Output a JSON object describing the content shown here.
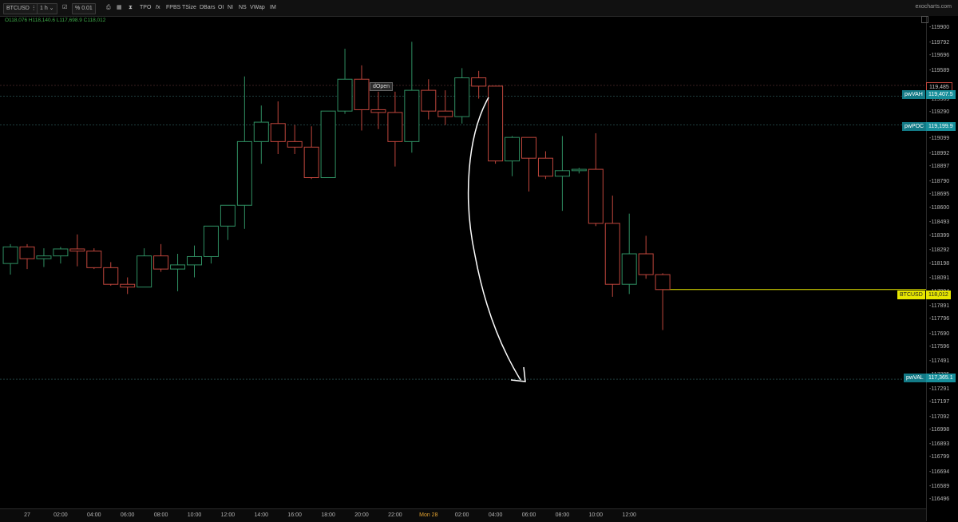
{
  "toolbar": {
    "symbol": "BTCUSD",
    "timeframe": "1 h",
    "percent_label": "%",
    "percent_value": "0.01",
    "items": [
      "TPO",
      "FPBS",
      "TSize",
      "DBars",
      "OI",
      "NI",
      "NS",
      "VWap",
      "IM"
    ]
  },
  "ohlc_line": "O118,076 H118,140.6 L117,698.9 C118,012",
  "brand": "exocharts.com",
  "annotation": "dOpen",
  "levels": [
    {
      "name": "pwVAH",
      "price": "119,407.5"
    },
    {
      "name": "pwPOC",
      "price": "119,199.9"
    },
    {
      "name": "pwVAL",
      "price": "117,365.1"
    }
  ],
  "current": {
    "symbol": "BTCUSD",
    "price": "118,012"
  },
  "top_price_label": "119,485",
  "colors": {
    "up": "#2f8f62",
    "down": "#c0463c",
    "background": "#000000",
    "level": "#178f9b",
    "current": "#e6e600"
  },
  "chart_data": {
    "type": "candlestick",
    "price_ticks": [
      119900,
      119792,
      119696,
      119589,
      119485,
      119383,
      119290,
      119190,
      119099,
      118992,
      118897,
      118790,
      118695,
      118600,
      118493,
      118399,
      118292,
      118198,
      118091,
      117994,
      117891,
      117796,
      117690,
      117596,
      117491,
      117395,
      117291,
      117197,
      117092,
      116998,
      116893,
      116799,
      116694,
      116589,
      116496
    ],
    "time_labels": [
      {
        "label": "27",
        "hour": 0
      },
      {
        "label": "02:00",
        "hour": 2
      },
      {
        "label": "04:00",
        "hour": 4
      },
      {
        "label": "06:00",
        "hour": 6
      },
      {
        "label": "08:00",
        "hour": 8
      },
      {
        "label": "10:00",
        "hour": 10
      },
      {
        "label": "12:00",
        "hour": 12
      },
      {
        "label": "14:00",
        "hour": 14
      },
      {
        "label": "16:00",
        "hour": 16
      },
      {
        "label": "18:00",
        "hour": 18
      },
      {
        "label": "20:00",
        "hour": 20
      },
      {
        "label": "22:00",
        "hour": 22
      },
      {
        "label": "Mon 28",
        "hour": 24
      },
      {
        "label": "02:00",
        "hour": 26
      },
      {
        "label": "04:00",
        "hour": 28
      },
      {
        "label": "06:00",
        "hour": 30
      },
      {
        "label": "08:00",
        "hour": 32
      },
      {
        "label": "10:00",
        "hour": 34
      },
      {
        "label": "12:00",
        "hour": 36
      }
    ],
    "candles": [
      {
        "h": -1,
        "o": 118200,
        "hi": 118340,
        "l": 118120,
        "c": 118320
      },
      {
        "h": 0,
        "o": 118320,
        "hi": 118340,
        "l": 118160,
        "c": 118235
      },
      {
        "h": 1,
        "o": 118235,
        "hi": 118310,
        "l": 118175,
        "c": 118255
      },
      {
        "h": 2,
        "o": 118255,
        "hi": 118320,
        "l": 118200,
        "c": 118305
      },
      {
        "h": 3,
        "o": 118305,
        "hi": 118410,
        "l": 118180,
        "c": 118290
      },
      {
        "h": 4,
        "o": 118290,
        "hi": 118310,
        "l": 118160,
        "c": 118170
      },
      {
        "h": 5,
        "o": 118170,
        "hi": 118210,
        "l": 118040,
        "c": 118050
      },
      {
        "h": 6,
        "o": 118050,
        "hi": 118100,
        "l": 117980,
        "c": 118030
      },
      {
        "h": 7,
        "o": 118030,
        "hi": 118310,
        "l": 118030,
        "c": 118255
      },
      {
        "h": 8,
        "o": 118255,
        "hi": 118340,
        "l": 118140,
        "c": 118160
      },
      {
        "h": 9,
        "o": 118160,
        "hi": 118270,
        "l": 118000,
        "c": 118190
      },
      {
        "h": 10,
        "o": 118190,
        "hi": 118330,
        "l": 118100,
        "c": 118250
      },
      {
        "h": 11,
        "o": 118250,
        "hi": 118460,
        "l": 118200,
        "c": 118470
      },
      {
        "h": 12,
        "o": 118470,
        "hi": 118600,
        "l": 118370,
        "c": 118620
      },
      {
        "h": 13,
        "o": 118620,
        "hi": 119550,
        "l": 118450,
        "c": 119080
      },
      {
        "h": 14,
        "o": 119080,
        "hi": 119340,
        "l": 118920,
        "c": 119220
      },
      {
        "h": 15,
        "o": 119210,
        "hi": 119370,
        "l": 118990,
        "c": 119080
      },
      {
        "h": 16,
        "o": 119080,
        "hi": 119200,
        "l": 118990,
        "c": 119040
      },
      {
        "h": 17,
        "o": 119040,
        "hi": 119190,
        "l": 118810,
        "c": 118820
      },
      {
        "h": 18,
        "o": 118820,
        "hi": 119250,
        "l": 118820,
        "c": 119300
      },
      {
        "h": 19,
        "o": 119300,
        "hi": 119750,
        "l": 119280,
        "c": 119530
      },
      {
        "h": 20,
        "o": 119530,
        "hi": 119630,
        "l": 119160,
        "c": 119310
      },
      {
        "h": 21,
        "o": 119310,
        "hi": 119440,
        "l": 119170,
        "c": 119290
      },
      {
        "h": 22,
        "o": 119290,
        "hi": 119440,
        "l": 118900,
        "c": 119080
      },
      {
        "h": 23,
        "o": 119080,
        "hi": 119800,
        "l": 119000,
        "c": 119450
      },
      {
        "h": 24,
        "o": 119450,
        "hi": 119530,
        "l": 119240,
        "c": 119300
      },
      {
        "h": 25,
        "o": 119300,
        "hi": 119450,
        "l": 119200,
        "c": 119260
      },
      {
        "h": 26,
        "o": 119260,
        "hi": 119610,
        "l": 119210,
        "c": 119540
      },
      {
        "h": 27,
        "o": 119540,
        "hi": 119590,
        "l": 119390,
        "c": 119480
      },
      {
        "h": 28,
        "o": 119480,
        "hi": 119420,
        "l": 118920,
        "c": 118940
      },
      {
        "h": 29,
        "o": 118940,
        "hi": 119120,
        "l": 118830,
        "c": 119110
      },
      {
        "h": 30,
        "o": 119110,
        "hi": 119110,
        "l": 118720,
        "c": 118960
      },
      {
        "h": 31,
        "o": 118960,
        "hi": 119010,
        "l": 118810,
        "c": 118830
      },
      {
        "h": 32,
        "o": 118830,
        "hi": 119120,
        "l": 118580,
        "c": 118870
      },
      {
        "h": 33,
        "o": 118870,
        "hi": 118890,
        "l": 118850,
        "c": 118880
      },
      {
        "h": 34,
        "o": 118880,
        "hi": 119140,
        "l": 118470,
        "c": 118490
      },
      {
        "h": 35,
        "o": 118490,
        "hi": 118690,
        "l": 117960,
        "c": 118050
      },
      {
        "h": 36,
        "o": 118050,
        "hi": 118560,
        "l": 117980,
        "c": 118270
      },
      {
        "h": 37,
        "o": 118270,
        "hi": 118400,
        "l": 118090,
        "c": 118120
      },
      {
        "h": 38,
        "o": 118120,
        "hi": 118130,
        "l": 117720,
        "c": 118012
      }
    ],
    "levels": [
      {
        "name": "pwVAH",
        "price": 119407.5
      },
      {
        "name": "pwPOC",
        "price": 119199.9
      },
      {
        "name": "pwVAL",
        "price": 117365.1
      }
    ],
    "current_price": 118012,
    "top_level": 119485,
    "dOpen_hour": 22.5
  }
}
